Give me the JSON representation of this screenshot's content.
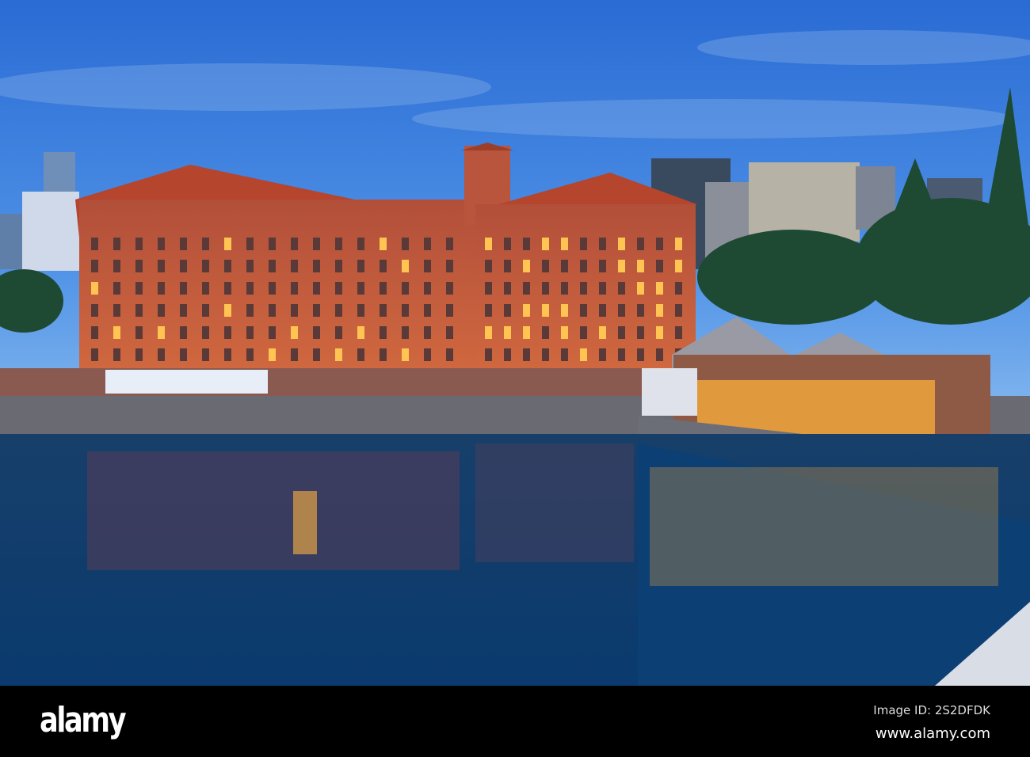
{
  "watermark": {
    "logo": "alamy",
    "image_id": "Image ID: 2S2DFDK",
    "site": "www.alamy.com"
  },
  "colors": {
    "sky_top": "#2b6fd6",
    "sky_bottom": "#6aa8ec",
    "brick": "#b9573f",
    "roof": "#b5452c",
    "water": "#0c3d6e",
    "light": "#ffc452"
  }
}
